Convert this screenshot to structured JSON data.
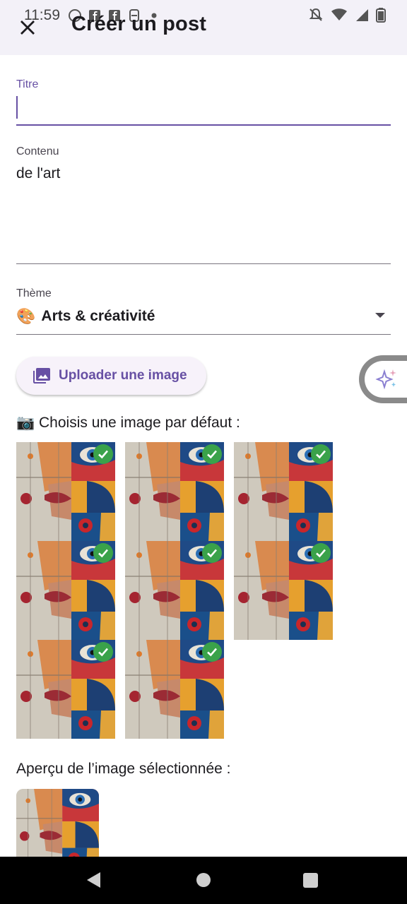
{
  "status_bar": {
    "time": "11:59"
  },
  "app_bar": {
    "title": "Créer un post",
    "close_icon": "close-icon"
  },
  "form": {
    "title_field": {
      "label": "Titre",
      "value": ""
    },
    "content_field": {
      "label": "Contenu",
      "value": "de l'art"
    },
    "theme_field": {
      "label": "Thème",
      "emoji": "🎨",
      "value": "Arts & créativité"
    }
  },
  "upload": {
    "label": "Uploader une image",
    "icon": "image-icon"
  },
  "defaults": {
    "emoji": "📷",
    "heading": "Choisis une image par défaut :",
    "images": [
      {
        "selected": true
      },
      {
        "selected": true
      },
      {
        "selected": true
      },
      {
        "selected": true
      },
      {
        "selected": true
      },
      {
        "selected": true
      },
      {
        "selected": true
      },
      {
        "selected": true
      }
    ]
  },
  "preview": {
    "heading": "Aperçu de l’image sélectionnée :"
  },
  "colors": {
    "accent": "#6750a4",
    "check": "#3aa24a",
    "navbar": "#000000"
  }
}
